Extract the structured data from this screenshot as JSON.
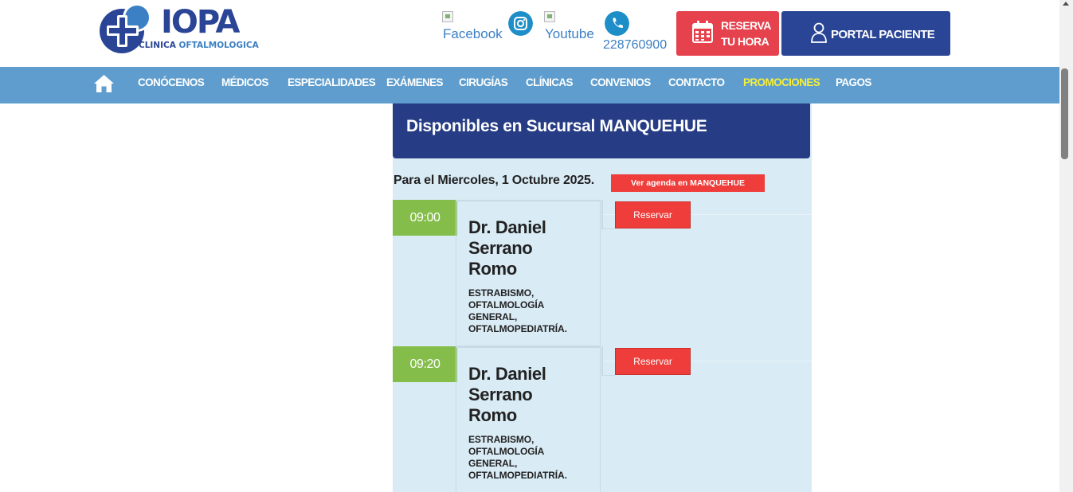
{
  "header": {
    "logo": {
      "brand": "IOPA",
      "sub_a": "CLINICA",
      "sub_b": "OFTALMOLOGICA"
    },
    "social": {
      "facebook_alt": "Facebook",
      "youtube_alt": "Youtube",
      "phone": "228760900"
    },
    "reserva_line1": "RESERVA",
    "reserva_line2": "TU HORA",
    "portal_label": "PORTAL PACIENTE"
  },
  "nav": {
    "items": [
      "CONÓCENOS",
      "MÉDICOS",
      "ESPECIALIDADES",
      "EXÁMENES",
      "CIRUGÍAS",
      "CLÍNICAS",
      "CONVENIOS",
      "CONTACTO",
      "PROMOCIONES",
      "PAGOS"
    ],
    "highlight_color": "#f5ef3a"
  },
  "main": {
    "title": "Disponibles en Sucursal MANQUEHUE",
    "date_line": "Para el Miercoles, 1 Octubre 2025.",
    "agenda_button": "Ver agenda en MANQUEHUE",
    "slots": [
      {
        "time": "09:00",
        "doctor_line1": "Dr. Daniel",
        "doctor_line2": "Serrano",
        "doctor_line3": "Romo",
        "spec_line1": "ESTRABISMO,",
        "spec_line2": "OFTALMOLOGÍA",
        "spec_line3": "GENERAL,",
        "spec_line4": "OFTALMOPEDIATRÍA.",
        "action": "Reservar"
      },
      {
        "time": "09:20",
        "doctor_line1": "Dr. Daniel",
        "doctor_line2": "Serrano",
        "doctor_line3": "Romo",
        "spec_line1": "ESTRABISMO,",
        "spec_line2": "OFTALMOLOGÍA",
        "spec_line3": "GENERAL,",
        "spec_line4": "OFTALMOPEDIATRÍA.",
        "action": "Reservar"
      }
    ]
  },
  "colors": {
    "brand_blue": "#2a4596",
    "nav_blue": "#5e9dcd",
    "reserve_red": "#ee3d3a",
    "time_green": "#85bd4a",
    "panel_bg": "#d9ebf5"
  }
}
